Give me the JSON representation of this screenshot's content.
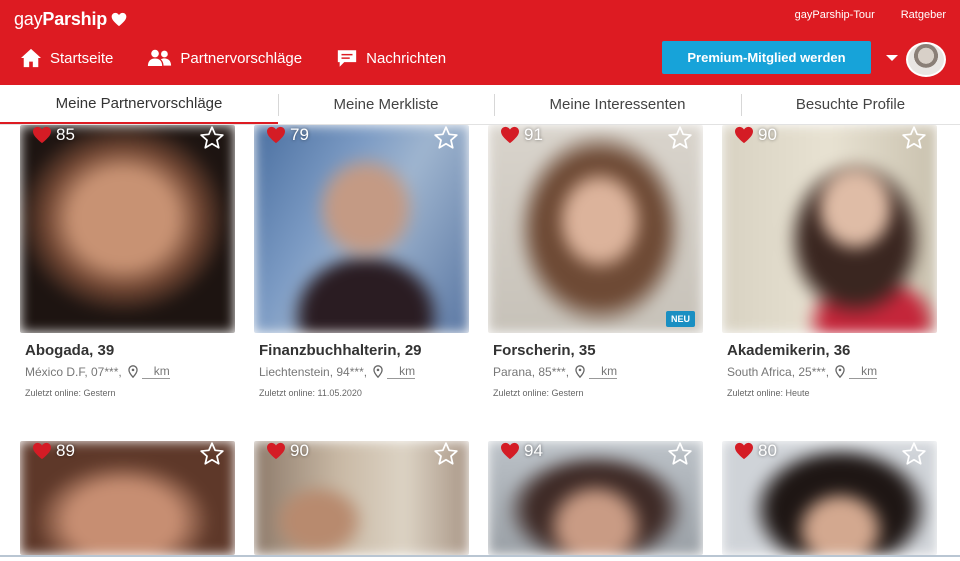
{
  "header": {
    "logo_prefix": "gay",
    "logo_main": "Parship",
    "links": [
      "gayParship-Tour",
      "Ratgeber"
    ],
    "nav": [
      {
        "label": "Startseite",
        "icon": "home-icon"
      },
      {
        "label": "Partnervorschläge",
        "icon": "people-icon"
      },
      {
        "label": "Nachrichten",
        "icon": "chat-bubble-icon"
      }
    ],
    "premium_label": "Premium-Mitglied werden",
    "brand_color": "#dd1b22",
    "premium_color": "#17a3d9"
  },
  "subnav": {
    "tabs": [
      "Meine Partnervorschläge",
      "Meine Merkliste",
      "Meine Interessenten",
      "Besuchte Profile"
    ],
    "active": 0
  },
  "cards": [
    {
      "match": "85",
      "title": "Abogada, 39",
      "location": "México D.F, 07***,",
      "km": "km",
      "online": "Zuletzt online: Gestern",
      "new": false
    },
    {
      "match": "79",
      "title": "Finanzbuchhalterin, 29",
      "location": "Liechtenstein, 94***,",
      "km": "km",
      "online": "Zuletzt online: 11.05.2020",
      "new": false
    },
    {
      "match": "91",
      "title": "Forscherin, 35",
      "location": "Parana, 85***,",
      "km": "km",
      "online": "Zuletzt online: Gestern",
      "new": true,
      "new_label": "NEU"
    },
    {
      "match": "90",
      "title": "Akademikerin, 36",
      "location": "South Africa, 25***,",
      "km": "km",
      "online": "Zuletzt online: Heute",
      "new": false
    },
    {
      "match": "89"
    },
    {
      "match": "90"
    },
    {
      "match": "94"
    },
    {
      "match": "80"
    }
  ]
}
